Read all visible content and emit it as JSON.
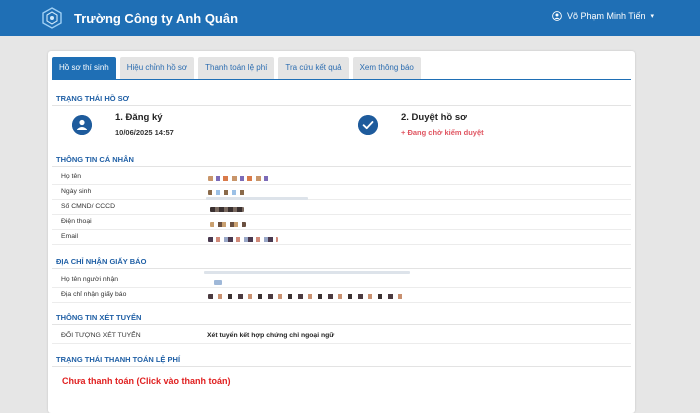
{
  "header": {
    "brand_name": "Trường Công ty Anh Quân",
    "user_name": "Võ Phạm Minh Tiến",
    "caret": "▾",
    "icons": {
      "logo": "logo-icon",
      "user": "user-circle-icon"
    }
  },
  "tabs": [
    {
      "label": "Hồ sơ thí sinh",
      "active": true
    },
    {
      "label": "Hiệu chỉnh hồ sơ",
      "active": false
    },
    {
      "label": "Thanh toán lệ phí",
      "active": false
    },
    {
      "label": "Tra cứu kết quả",
      "active": false
    },
    {
      "label": "Xem thông báo",
      "active": false
    }
  ],
  "status_section": {
    "title": "TRẠNG THÁI HỒ SƠ",
    "step1": {
      "title": "1. Đăng ký",
      "datetime": "10/06/2025 14:57",
      "icon": "user-icon"
    },
    "step2": {
      "title": "2. Duyệt hồ sơ",
      "status": "+ Đang chờ kiểm duyệt",
      "icon": "check-icon"
    }
  },
  "personal": {
    "title": "THÔNG TIN CÁ NHÂN",
    "rows": [
      {
        "label": "Họ tên"
      },
      {
        "label": "Ngày sinh"
      },
      {
        "label": "Số CMND/ CCCD"
      },
      {
        "label": "Điện thoại"
      },
      {
        "label": "Email"
      }
    ]
  },
  "address": {
    "title": "ĐỊA CHỈ NHẬN GIẤY BÁO",
    "rows": [
      {
        "label": "Họ tên người nhận"
      },
      {
        "label": "Địa chỉ nhận giấy báo"
      }
    ]
  },
  "admission": {
    "title": "THÔNG TIN XÉT TUYỂN",
    "rows": [
      {
        "label": "ĐỐI TƯỢNG XÉT TUYỂN",
        "value": "Xét tuyển kết hợp chứng chỉ ngoại ngữ"
      }
    ]
  },
  "fee": {
    "title": "TRẠNG THÁI THANH TOÁN LỆ PHÍ",
    "status": "Chưa thanh toán (Click vào thanh toán)"
  },
  "colors": {
    "primary": "#1f6fb5",
    "section_title": "#1f5fa5",
    "pending": "#e05561",
    "unpaid": "#e02020"
  }
}
